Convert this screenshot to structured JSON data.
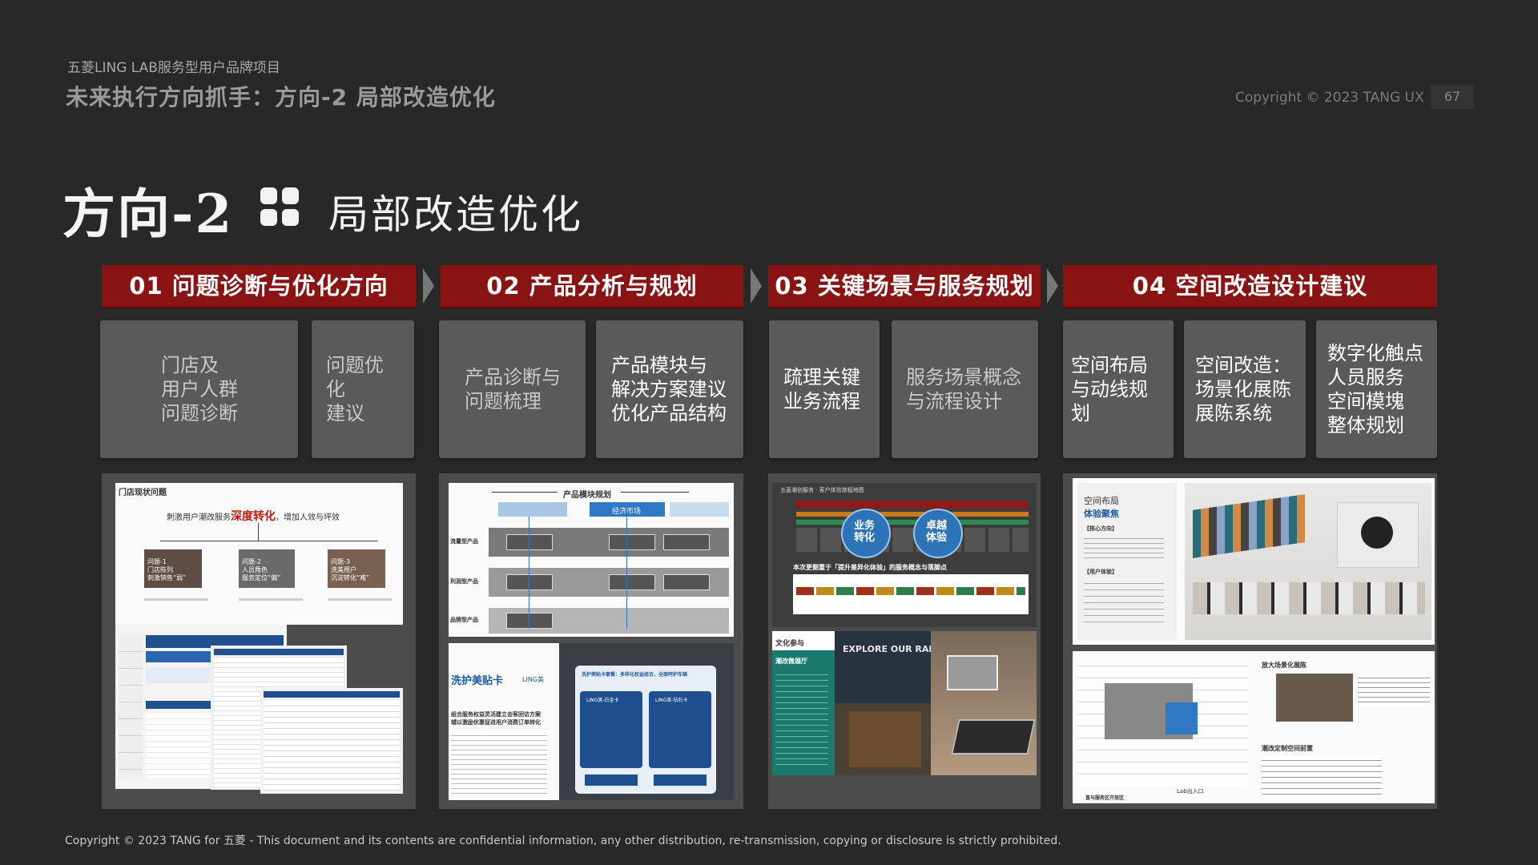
{
  "header": {
    "project": "五菱LING LAB服务型用户品牌项目",
    "subtitle": "未来执行方向抓手：方向-2 局部改造优化",
    "copyright": "Copyright © 2023 TANG UX",
    "page_number": "67"
  },
  "hero": {
    "direction": "方向-2",
    "icon": "four-squares-icon",
    "title": "局部改造优化"
  },
  "phases": [
    {
      "label": "01 问题诊断与优化方向"
    },
    {
      "label": "02  产品分析与规划"
    },
    {
      "label": "03  关键场景与服务规划"
    },
    {
      "label": "04 空间改造设计建议"
    }
  ],
  "cards": [
    "门店及\n用户人群\n问题诊断",
    "问题优化\n建议",
    "产品诊断与\n问题梳理",
    "产品模块与\n解决方案建议\n优化产品结构",
    "疏理关键\n业务流程",
    "服务场景概念\n与流程设计",
    "空间布局\n与动线规划",
    "空间改造：\n场景化展陈\n展陈系统",
    "数字化触点\n人员服务\n空间模塊\n整体规划"
  ],
  "thumbs": {
    "p1": {
      "title": "门店现状问题",
      "headline_a": "刺激用户潮改服务",
      "headline_b": "深度转化",
      "headline_c": "，增加人效与坪效",
      "items": [
        "问题-1\n门店陈列\n刺激销售“弱”",
        "问题-2\n人员角色\n服务定位“偏”",
        "问题-3\n洗美用户\n沉淀转化“难”"
      ]
    },
    "p2": {
      "title": "产品模块规划",
      "tag": "经济市场",
      "rows": [
        "流量型产品",
        "利润型产品",
        "品牌型产品"
      ],
      "card_title": "洗护美贴卡",
      "card_sub": "LING美",
      "card_text": "组合服务权益灵活建立会客回访方案\n辅以激励优惠促进用户消费订单转化",
      "card_head": "洗护美贴卡套餐：多样化权益组合，全面呵护车辆",
      "card_a": "LING美-白金卡",
      "card_b": "LING美-钻石卡"
    },
    "p3": {
      "title": "五菱潮创服务 · 客户体验旅程地图",
      "bubble_a": "业务\n转化",
      "bubble_b": "卓越\n体验",
      "headline": "本次更侧重于「提升差异化体验」的服务概念与落脚点",
      "panel_title": "文化参与",
      "panel_sub": "潮改微展厅",
      "sign": "EXPLORE OUR RANGE"
    },
    "p4": {
      "title": "空间布局",
      "sub": "体验聚焦",
      "label_a": "【核心方向】",
      "label_b": "【用户体验】",
      "plan_a": "放大场景化展陈",
      "plan_b": "潮改定制空间前置",
      "plan_foot": "Lab出入口",
      "plan_bottom": "直与服务区开放区"
    }
  },
  "footer": "Copyright © 2023 TANG for 五菱 - This document and its contents are confidential information, any other distribution, re-transmission, copying or disclosure is strictly prohibited."
}
